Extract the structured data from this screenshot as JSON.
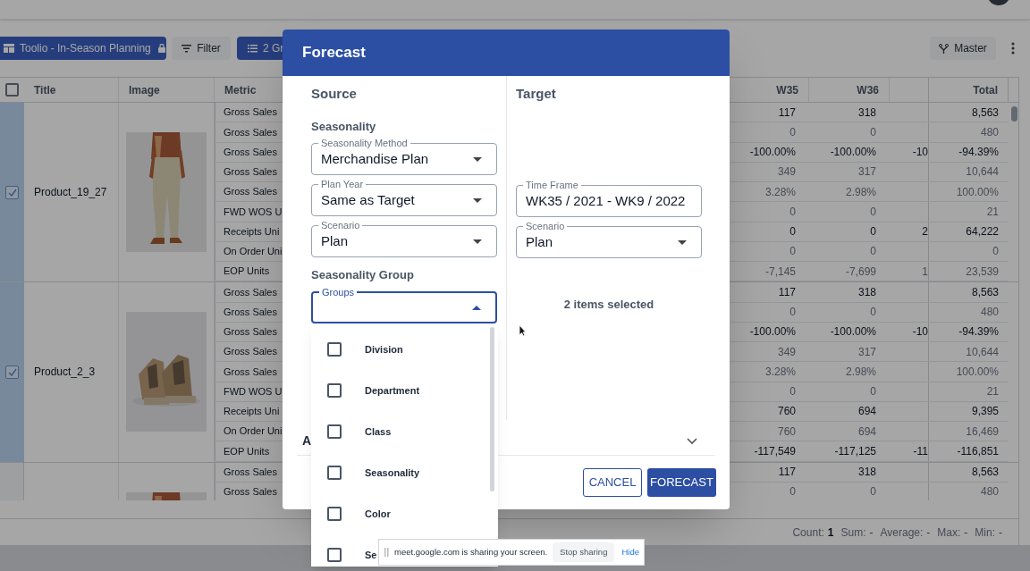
{
  "toolbar": {
    "view_button": "Toolio - In-Season Planning",
    "filter_button": "Filter",
    "group_button": "2 Gr",
    "branch_button": "Master"
  },
  "table": {
    "header_checked": false,
    "columns": [
      "Title",
      "Image",
      "Metric",
      "W35",
      "W36",
      "Total"
    ],
    "groups": [
      {
        "title": "Product_19_27",
        "selected": true,
        "rows": [
          {
            "metric": "Gross Sales",
            "w35": "117",
            "w36": "318",
            "total": "8,563",
            "emphasized": true
          },
          {
            "metric": "Gross Sales",
            "w35": "0",
            "w36": "0",
            "total": "480",
            "emphasized": false
          },
          {
            "metric": "Gross Sales",
            "w35": "-100.00%",
            "w36": "-100.00%",
            "column_3": "-10",
            "total": "-94.39%",
            "emphasized": true
          },
          {
            "metric": "Gross Sales",
            "w35": "349",
            "w36": "317",
            "total": "10,644",
            "emphasized": false
          },
          {
            "metric": "Gross Sales",
            "w35": "3.28%",
            "w36": "2.98%",
            "total": "100.00%",
            "emphasized": false
          },
          {
            "metric": "FWD WOS U",
            "w35": "0",
            "w36": "0",
            "total": "21",
            "emphasized": false
          },
          {
            "metric": "Receipts Uni",
            "w35": "0",
            "w36": "0",
            "column_3": "2",
            "total": "64,222",
            "emphasized": true
          },
          {
            "metric": "On Order Uni",
            "w35": "0",
            "w36": "0",
            "total": "0",
            "emphasized": false
          },
          {
            "metric": "EOP Units",
            "w35": "-7,145",
            "w36": "-7,699",
            "column_3": "1",
            "total": "23,539",
            "emphasized": false
          }
        ]
      },
      {
        "title": "Product_2_3",
        "selected": true,
        "rows": [
          {
            "metric": "Gross Sales",
            "w35": "117",
            "w36": "318",
            "total": "8,563",
            "emphasized": true
          },
          {
            "metric": "Gross Sales",
            "w35": "0",
            "w36": "0",
            "total": "480",
            "emphasized": false
          },
          {
            "metric": "Gross Sales",
            "w35": "-100.00%",
            "w36": "-100.00%",
            "column_3": "-10",
            "total": "-94.39%",
            "emphasized": true
          },
          {
            "metric": "Gross Sales",
            "w35": "349",
            "w36": "317",
            "total": "10,644",
            "emphasized": false
          },
          {
            "metric": "Gross Sales",
            "w35": "3.28%",
            "w36": "2.98%",
            "total": "100.00%",
            "emphasized": false
          },
          {
            "metric": "FWD WOS U",
            "w35": "0",
            "w36": "0",
            "total": "21",
            "emphasized": false
          },
          {
            "metric": "Receipts Uni",
            "w35": "760",
            "w36": "694",
            "total": "9,395",
            "emphasized": true
          },
          {
            "metric": "On Order Uni",
            "w35": "760",
            "w36": "694",
            "total": "16,469",
            "emphasized": false
          },
          {
            "metric": "EOP Units",
            "w35": "-117,549",
            "w36": "-117,125",
            "column_3": "-11",
            "total": "-116,851",
            "emphasized": true
          }
        ]
      },
      {
        "selected": false,
        "rows": [
          {
            "metric": "Gross Sales",
            "w35": "117",
            "w36": "318",
            "total": "8,563",
            "emphasized": true
          },
          {
            "metric": "Gross Sales",
            "w35": "0",
            "w36": "0",
            "total": "480",
            "emphasized": false
          }
        ]
      }
    ]
  },
  "status_bar": [
    {
      "label": "Count:",
      "value": "1"
    },
    {
      "label": "Sum:",
      "value": "-"
    },
    {
      "label": "Average:",
      "value": "-"
    },
    {
      "label": "Max:",
      "value": "-"
    },
    {
      "label": "Min:",
      "value": "-"
    }
  ],
  "dialog": {
    "title": "Forecast",
    "source": {
      "heading": "Source",
      "section": "Seasonality",
      "fields": [
        {
          "label": "Seasonality Method",
          "value": "Merchandise Plan"
        },
        {
          "label": "Plan Year",
          "value": "Same as Target"
        },
        {
          "label": "Scenario",
          "value": "Plan"
        }
      ],
      "group_heading": "Seasonality Group",
      "groups_field": {
        "label": "Groups",
        "expanded": true
      }
    },
    "target": {
      "heading": "Target",
      "fields": [
        {
          "label": "Time Frame",
          "value": "WK35 / 2021 - WK9 / 2022",
          "kind": "text"
        },
        {
          "label": "Scenario",
          "value": "Plan",
          "kind": "select"
        }
      ],
      "selection_summary": "2 items selected"
    },
    "accordion": {
      "label": "A"
    },
    "buttons": [
      {
        "label": "CANCEL",
        "kind": "outlined"
      },
      {
        "label": "FORECAST",
        "kind": "contained"
      }
    ]
  },
  "groups_menu": [
    {
      "label": "Division",
      "checked": false
    },
    {
      "label": "Department",
      "checked": false
    },
    {
      "label": "Class",
      "checked": false
    },
    {
      "label": "Seasonality",
      "checked": false
    },
    {
      "label": "Color",
      "checked": false
    },
    {
      "label": "Se",
      "checked": false
    }
  ],
  "share_bar": {
    "message": "meet.google.com is sharing your screen.",
    "stop_button": "Stop sharing",
    "hide_link": "Hide"
  }
}
